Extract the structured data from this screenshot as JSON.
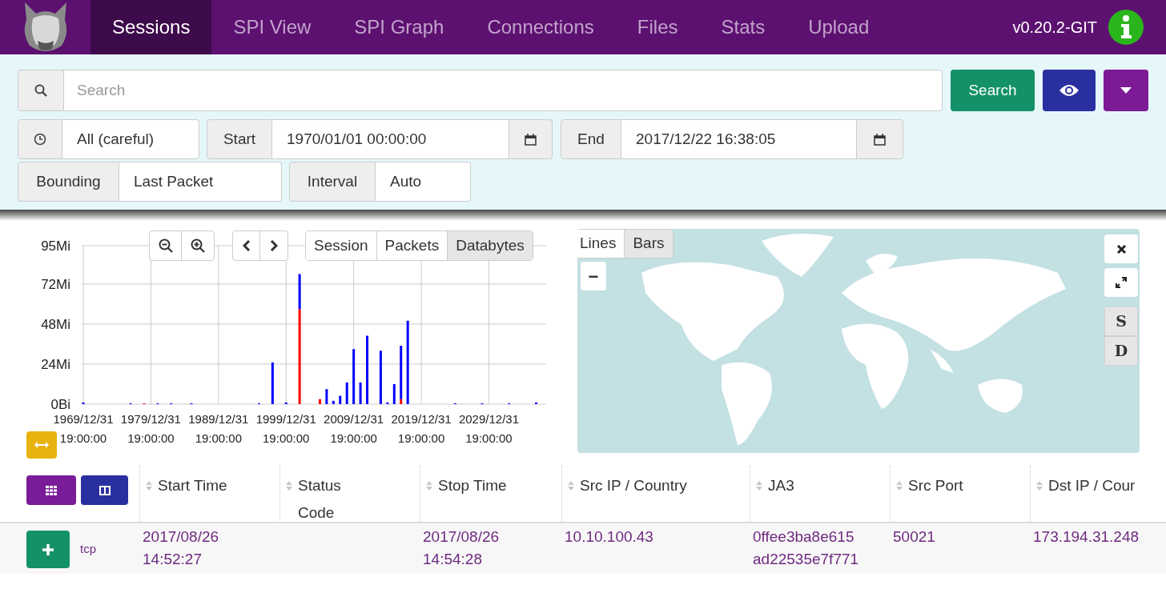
{
  "nav": {
    "tabs": [
      {
        "label": "Sessions",
        "selected": true
      },
      {
        "label": "SPI View",
        "selected": false
      },
      {
        "label": "SPI Graph",
        "selected": false
      },
      {
        "label": "Connections",
        "selected": false
      },
      {
        "label": "Files",
        "selected": false
      },
      {
        "label": "Stats",
        "selected": false
      },
      {
        "label": "Upload",
        "selected": false
      }
    ],
    "version": "v0.20.2-GIT"
  },
  "search": {
    "placeholder": "Search",
    "button": "Search"
  },
  "time": {
    "range": "All (careful)",
    "start_label": "Start",
    "start": "1970/01/01 00:00:00",
    "end_label": "End",
    "end": "2017/12/22 16:38:05",
    "bounding_label": "Bounding",
    "bounding": "Last Packet",
    "interval_label": "Interval",
    "interval": "Auto"
  },
  "graph": {
    "modes": [
      {
        "label": "Session",
        "selected": false
      },
      {
        "label": "Packets",
        "selected": false
      },
      {
        "label": "Databytes",
        "selected": true
      }
    ],
    "chart_data": {
      "type": "bar",
      "stacked": true,
      "grid": true,
      "ylim": [
        0,
        95
      ],
      "categories": [
        "1969/12/31 19:00:00",
        null,
        null,
        null,
        null,
        null,
        null,
        null,
        null,
        null,
        "1979/12/31 19:00:00",
        null,
        null,
        null,
        null,
        null,
        null,
        null,
        null,
        null,
        "1989/12/31 19:00:00",
        null,
        null,
        null,
        null,
        null,
        null,
        null,
        null,
        null,
        "1999/12/31 19:00:00",
        null,
        null,
        null,
        null,
        null,
        null,
        null,
        null,
        null,
        "2009/12/31 19:00:00",
        null,
        null,
        null,
        null,
        null,
        null,
        null,
        null,
        null,
        "2019/12/31 19:00:00",
        null,
        null,
        null,
        null,
        null,
        null,
        null,
        null,
        null,
        "2029/12/31 19:00:00",
        null,
        null,
        null,
        null,
        null,
        null,
        null
      ],
      "series": [
        {
          "color": "#ff0000",
          "values": [
            0,
            0,
            0,
            0,
            0,
            0,
            0,
            0,
            0,
            0.5,
            0,
            0,
            0,
            0,
            0,
            0,
            0,
            0,
            0,
            0,
            0,
            0,
            0,
            0,
            0,
            0,
            0,
            0,
            0,
            0,
            0,
            0,
            57,
            0,
            0,
            3,
            0,
            0,
            0,
            0,
            0,
            0,
            0,
            0,
            0,
            0,
            0,
            3,
            0,
            0,
            0,
            0,
            0,
            0,
            0,
            0,
            0,
            0,
            0,
            0,
            0,
            0,
            0,
            0,
            0,
            0,
            0,
            0
          ]
        },
        {
          "color": "#0000ff",
          "values": [
            1,
            0,
            0,
            0,
            0,
            0,
            0,
            0.5,
            0,
            0,
            0,
            0.5,
            0,
            0.5,
            0,
            0,
            0.5,
            0,
            0,
            0,
            0,
            0,
            0,
            0,
            0,
            0,
            0.5,
            0,
            25,
            0,
            1,
            0,
            21,
            0,
            0,
            0,
            9,
            2,
            5,
            13,
            33,
            13,
            41,
            0,
            32,
            1,
            12,
            32,
            50,
            0,
            0,
            0,
            0,
            0,
            0,
            0.5,
            0,
            0,
            0,
            0.5,
            0,
            0,
            0,
            0.5,
            0,
            0,
            0,
            1
          ]
        }
      ],
      "yticks": [
        {
          "value": 0,
          "label": "0Bi"
        },
        {
          "value": 24,
          "label": "24Mi"
        },
        {
          "value": 48,
          "label": "48Mi"
        },
        {
          "value": 72,
          "label": "72Mi"
        },
        {
          "value": 95,
          "label": "95Mi"
        }
      ]
    }
  },
  "map": {
    "styles": [
      {
        "label": "Lines",
        "selected": false
      },
      {
        "label": "Bars",
        "selected": true
      }
    ],
    "zoom_out": "−",
    "toggles": [
      "S",
      "D"
    ]
  },
  "table": {
    "columns": [
      "Start Time",
      "Status Code",
      "Stop Time",
      "Src IP / Country",
      "JA3",
      "Src Port",
      "Dst IP / Cour"
    ],
    "rows": [
      {
        "protocol": "tcp",
        "start_time": "2017/08/26 14:52:27",
        "stop_time": "2017/08/26 14:54:28",
        "src_ip": "10.10.100.43",
        "ja3": "0ffee3ba8e615ad22535e7f771",
        "src_port": "50021",
        "dst_ip": "173.194.31.248"
      }
    ]
  }
}
